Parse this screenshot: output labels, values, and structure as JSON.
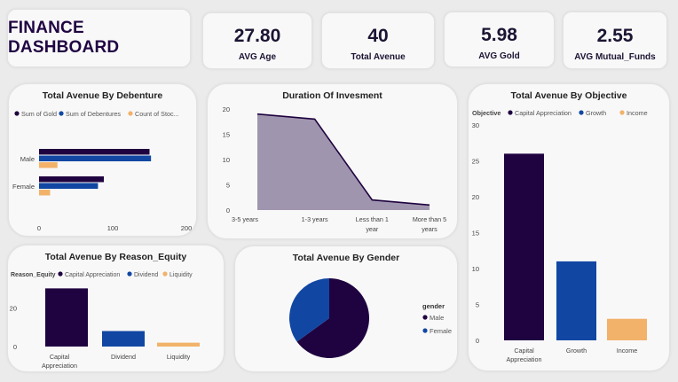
{
  "dashboard": {
    "title": "FINANCE DASHBOARD"
  },
  "kpis": [
    {
      "value": "27.80",
      "label": "AVG Age"
    },
    {
      "value": "40",
      "label": "Total Avenue"
    },
    {
      "value": "5.98",
      "label": "AVG Gold"
    },
    {
      "value": "2.55",
      "label": "AVG Mutual_Funds"
    }
  ],
  "colors": {
    "dark_purple": "#1f0340",
    "blue": "#1147a3",
    "orange": "#f2b26a",
    "area_fill": "#9b8fab",
    "area_line": "#1f0340"
  },
  "chart_data": [
    {
      "id": "debenture",
      "type": "bar",
      "orientation": "horizontal",
      "title": "Total Avenue By Debenture",
      "categories": [
        "Male",
        "Female"
      ],
      "series": [
        {
          "name": "Sum of Gold",
          "values": [
            150,
            88
          ]
        },
        {
          "name": "Sum of Debentures",
          "values": [
            152,
            80
          ]
        },
        {
          "name": "Count of Stoc...",
          "values": [
            25,
            15
          ]
        }
      ],
      "xlim": [
        0,
        200
      ],
      "xticks": [
        "0",
        "100",
        "200"
      ],
      "legend": "top"
    },
    {
      "id": "duration",
      "type": "area",
      "title": "Duration Of Invesment",
      "categories": [
        "3-5 years",
        "1-3 years",
        "Less than 1 year",
        "More than 5 years"
      ],
      "category_lines": [
        [
          "3-5 years"
        ],
        [
          "1-3 years"
        ],
        [
          "Less than 1",
          "year"
        ],
        [
          "More than 5",
          "years"
        ]
      ],
      "values": [
        19,
        18,
        2,
        1
      ],
      "ylim": [
        0,
        20
      ],
      "yticks": [
        "0",
        "5",
        "10",
        "15",
        "20"
      ]
    },
    {
      "id": "objective",
      "type": "bar",
      "title": "Total Avenue By Objective",
      "legend_title": "Objective",
      "categories": [
        "Capital Appreciation",
        "Growth",
        "Income"
      ],
      "category_lines": [
        [
          "Capital",
          "Appreciation"
        ],
        [
          "Growth"
        ],
        [
          "Income"
        ]
      ],
      "legend_items": [
        "Capital Appreciation",
        "Growth",
        "Income"
      ],
      "values": [
        26,
        11,
        3
      ],
      "ylim": [
        0,
        30
      ],
      "yticks": [
        "0",
        "5",
        "10",
        "15",
        "20",
        "25",
        "30"
      ],
      "legend": "top"
    },
    {
      "id": "reason",
      "type": "bar",
      "title": "Total Avenue By Reason_Equity",
      "legend_title": "Reason_Equity",
      "categories": [
        "Capital Appreciation",
        "Dividend",
        "Liquidity"
      ],
      "category_lines": [
        [
          "Capital",
          "Appreciation"
        ],
        [
          "Dividend"
        ],
        [
          "Liquidity"
        ]
      ],
      "legend_items": [
        "Capital Appreciation",
        "Dividend",
        "Liquidity"
      ],
      "values": [
        30,
        8,
        2
      ],
      "ylim": [
        0,
        32
      ],
      "yticks": [
        "0",
        "20"
      ],
      "legend": "top"
    },
    {
      "id": "gender",
      "type": "pie",
      "title": "Total Avenue By Gender",
      "legend_title": "gender",
      "categories": [
        "Male",
        "Female"
      ],
      "values": [
        26,
        14
      ],
      "legend": "right"
    }
  ]
}
